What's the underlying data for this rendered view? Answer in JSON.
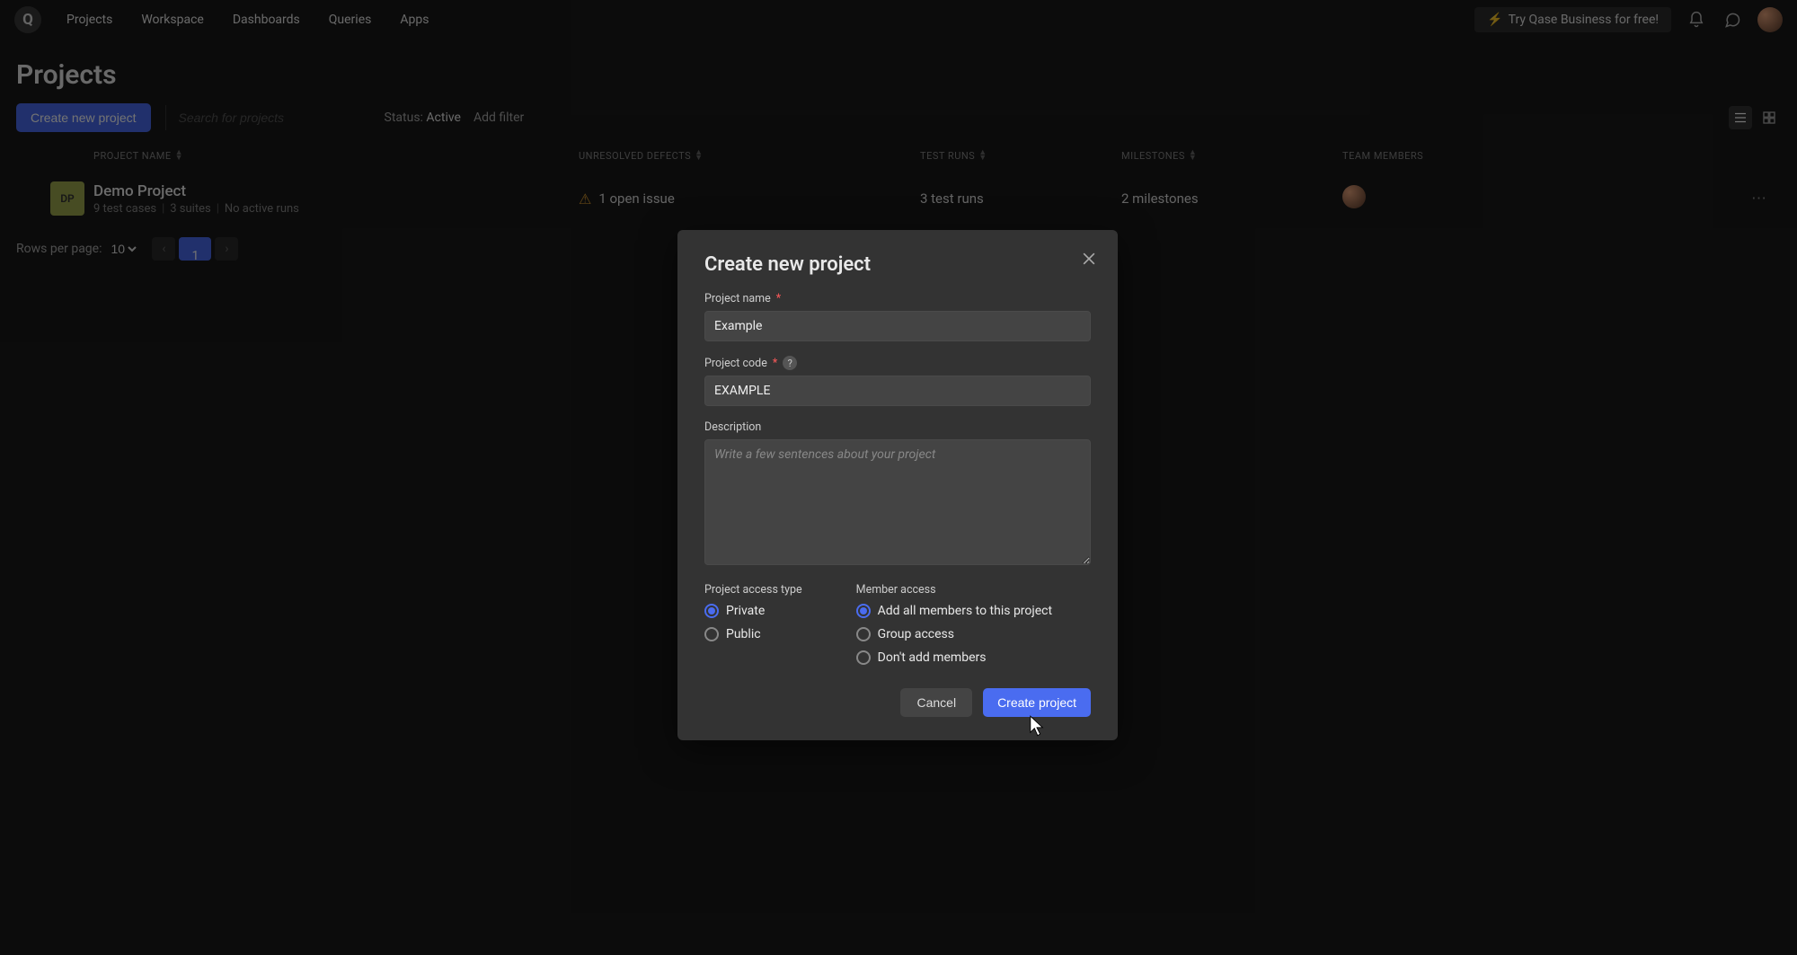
{
  "nav": {
    "items": [
      "Projects",
      "Workspace",
      "Dashboards",
      "Queries",
      "Apps"
    ],
    "trial_label": "Try Qase Business for free!"
  },
  "page": {
    "title": "Projects",
    "create_btn": "Create new project",
    "search_placeholder": "Search for projects",
    "status_filter_label": "Status:",
    "status_filter_value": "Active",
    "add_filter_label": "Add filter"
  },
  "table": {
    "headers": {
      "name": "PROJECT NAME",
      "defects": "UNRESOLVED DEFECTS",
      "runs": "TEST RUNS",
      "milestones": "MILESTONES",
      "members": "TEAM MEMBERS"
    },
    "rows": [
      {
        "badge": "DP",
        "name": "Demo Project",
        "meta": {
          "cases": "9 test cases",
          "suites": "3 suites",
          "runs": "No active runs"
        },
        "defects": "1 open issue",
        "test_runs": "3 test runs",
        "milestones": "2 milestones"
      }
    ]
  },
  "pager": {
    "rows_label": "Rows per page:",
    "rows_value": "10",
    "page": "1"
  },
  "modal": {
    "title": "Create new project",
    "fields": {
      "name_label": "Project name",
      "name_value": "Example",
      "code_label": "Project code",
      "code_value": "EXAMPLE",
      "desc_label": "Description",
      "desc_placeholder": "Write a few sentences about your project"
    },
    "access": {
      "col_label": "Project access type",
      "options": [
        "Private",
        "Public"
      ],
      "selected": "Private"
    },
    "member": {
      "col_label": "Member access",
      "options": [
        "Add all members to this project",
        "Group access",
        "Don't add members"
      ],
      "selected": "Add all members to this project"
    },
    "footer": {
      "cancel": "Cancel",
      "submit": "Create project"
    }
  }
}
